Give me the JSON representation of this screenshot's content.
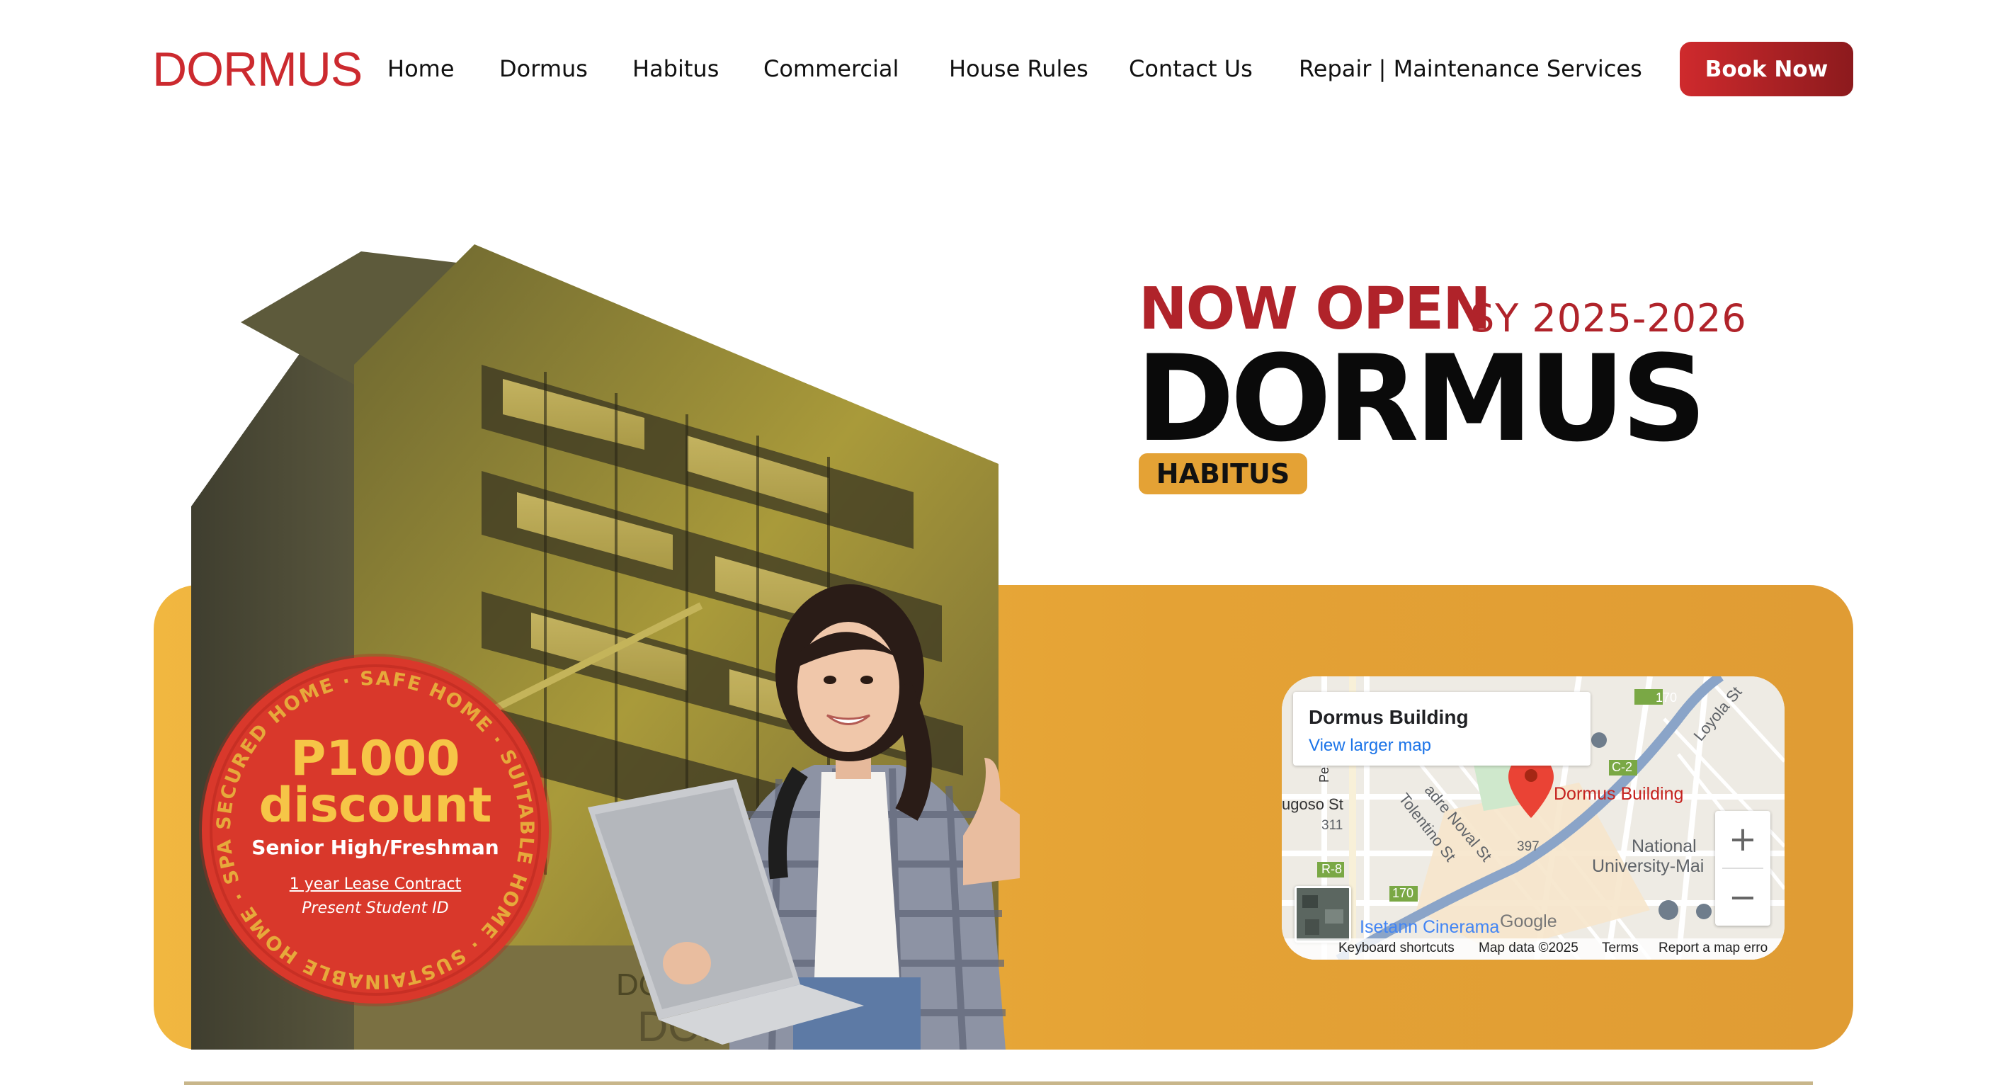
{
  "nav": {
    "logo": "DORMUS",
    "items": [
      {
        "label": "Home"
      },
      {
        "label": "Dormus"
      },
      {
        "label": "Habitus"
      },
      {
        "label": "Commercial"
      },
      {
        "label": "House Rules"
      },
      {
        "label": "Contact Us"
      },
      {
        "label": "Repair | Maintenance Services"
      }
    ],
    "cta": "Book Now"
  },
  "hero": {
    "now_open": "NOW OPEN",
    "school_year": "SY 2025-2026",
    "title": "DORMUS",
    "badge": "HABITUS"
  },
  "seal": {
    "amount": "P1000",
    "discount": "discount",
    "audience": "Senior High/Freshman",
    "lease": "1 year Lease Contract",
    "requirement": "Present Student ID",
    "ring_text": "SECURED HOME · SAFE HOME · SUITABLE HOME · SUSTAINABLE HOME · SPACIOUS HOME ·"
  },
  "map": {
    "place_title": "Dormus Building",
    "larger_map": "View larger map",
    "pin_label": "Dormus Building",
    "labels": {
      "loyola": "Loyola St",
      "tolentino": "Tolentino St",
      "noval": "adre Noval St",
      "lugoso": "ugoso St",
      "national": "National",
      "university": "University-Mai",
      "isetann": "Isetann Cinerama",
      "n311": "311",
      "n397": "397",
      "n170a": "170",
      "n170b": "170",
      "c2": "C-2",
      "r8": "R-8",
      "pe": "Pe"
    },
    "zoom_in": "+",
    "zoom_out": "−",
    "google": "Google",
    "footer": {
      "shortcuts": "Keyboard shortcuts",
      "mapdata": "Map data ©2025",
      "terms": "Terms",
      "report": "Report a map erro"
    }
  },
  "colors": {
    "brand_red": "#cc2a2f",
    "deep_red": "#b0232a",
    "accent_orange": "#e4a235",
    "seal_red": "#d9382b",
    "seal_yellow": "#f6c547"
  }
}
